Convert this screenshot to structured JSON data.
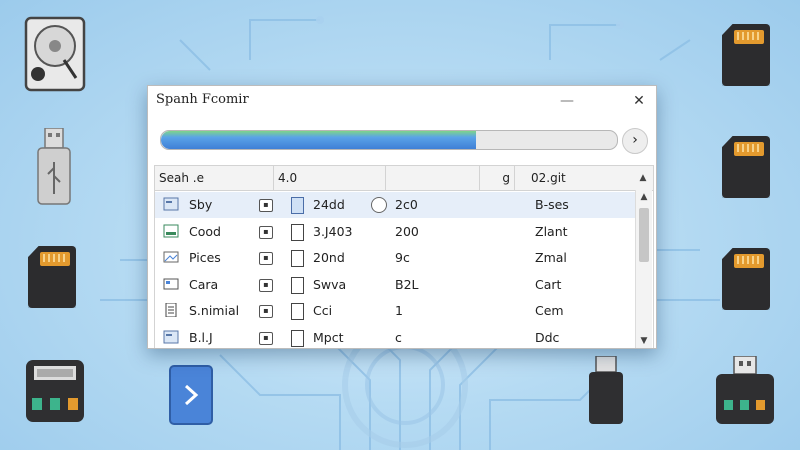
{
  "window": {
    "title": "Spanh Fcomir",
    "minimize_label": "—",
    "close_label": "✕",
    "progress_percent": 69,
    "next_label": "›"
  },
  "table": {
    "headers": [
      "Seah .e",
      "4.0",
      "",
      "g",
      "02.git"
    ],
    "rows": [
      {
        "name": "Sby",
        "icon": "file-icon",
        "checkbox": "▪",
        "doc": "24dd",
        "col4": "2c0",
        "col5": "B-ses",
        "radio": true,
        "selected": true
      },
      {
        "name": "Cood",
        "icon": "image-icon",
        "checkbox": "▪",
        "doc": "3.J403",
        "col4": "200",
        "col5": "Zlant"
      },
      {
        "name": "Pices",
        "icon": "pictures-icon",
        "checkbox": "▪",
        "doc": "20nd",
        "col4": "9c",
        "col5": "Zmal"
      },
      {
        "name": "Cara",
        "icon": "card-icon",
        "checkbox": "▪",
        "doc": "Swva",
        "col4": "B2L",
        "col5": "Cart"
      },
      {
        "name": "S.nimial",
        "icon": "document-icon",
        "checkbox": "▪",
        "doc": "Cci",
        "col4": "1",
        "col5": "Cem"
      },
      {
        "name": "B.l.J",
        "icon": "file-icon",
        "checkbox": "▪",
        "doc": "Mpct",
        "col4": "c",
        "col5": "Ddc"
      }
    ]
  },
  "colors": {
    "accent": "#3f7fd6",
    "selection": "#e6eef9",
    "card": "#2c2c2e",
    "pins": "#e39a2e",
    "storage_green": "#3db48c"
  }
}
